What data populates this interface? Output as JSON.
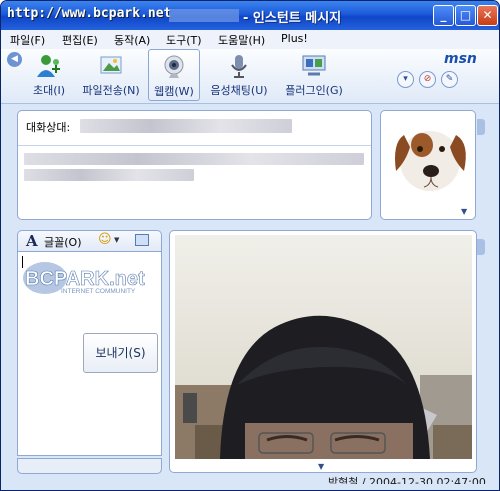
{
  "window": {
    "url_watermark": "http://www.bcpark.net",
    "title": "- 인스턴트 메시지",
    "controls": {
      "minimize": "_",
      "maximize": "□",
      "close": "✕"
    }
  },
  "menu": [
    "파일(F)",
    "편집(E)",
    "동작(A)",
    "도구(T)",
    "도움말(H)",
    "Plus!"
  ],
  "toolbar": {
    "items": [
      {
        "label": "초대(I)",
        "icon": "invite-icon"
      },
      {
        "label": "파일전송(N)",
        "icon": "file-transfer-icon"
      },
      {
        "label": "웹캠(W)",
        "icon": "webcam-icon"
      },
      {
        "label": "음성채팅(U)",
        "icon": "voice-chat-icon"
      },
      {
        "label": "플러그인(G)",
        "icon": "plugin-icon"
      }
    ],
    "brand": "msn"
  },
  "conversation": {
    "label": "대화상대:"
  },
  "input": {
    "font_label": "글꼴(O)",
    "send_label": "보내기(S)",
    "logo_main": "BCPARK.net",
    "logo_sub": "INTERNET COMMUNITY"
  },
  "webcam": {
    "caption": "박형철 / 2004-12-30 02:47:00"
  },
  "colors": {
    "titlebar": "#1c5ad8",
    "window_bg": "#d9e6f7",
    "panel_border": "#8fa9d4"
  }
}
